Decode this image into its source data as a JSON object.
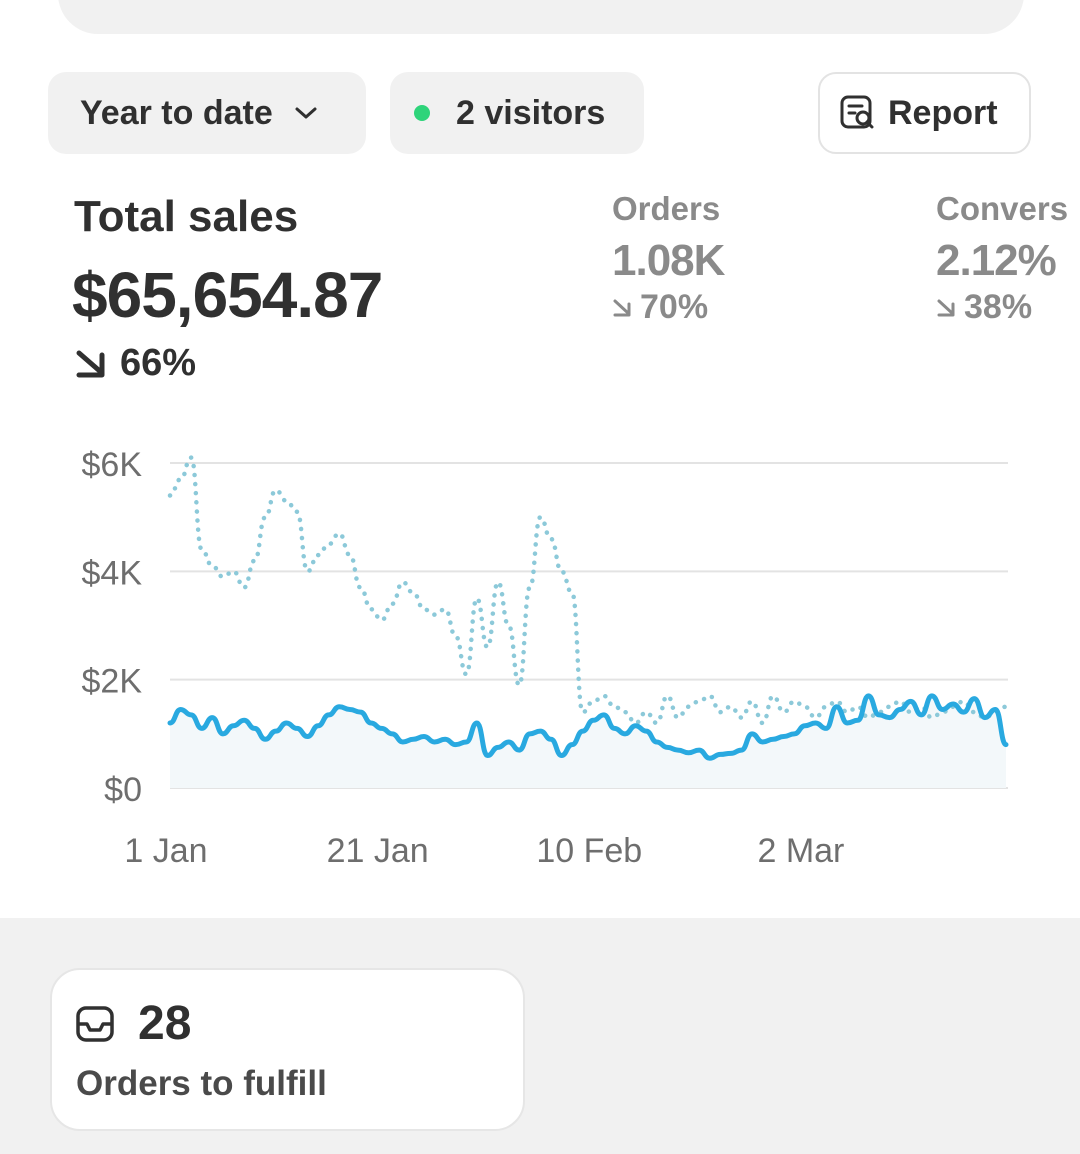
{
  "filters": {
    "date_range": "Year to date",
    "visitors": "2 visitors",
    "report_label": "Report"
  },
  "metrics": {
    "total_sales": {
      "title": "Total sales",
      "value": "$65,654.87",
      "change": "66%"
    },
    "orders": {
      "title": "Orders",
      "value": "1.08K",
      "change": "70%"
    },
    "conversion": {
      "title": "Convers",
      "value": "2.12%",
      "change": "38%"
    }
  },
  "colors": {
    "current_line": "#29a9e0",
    "previous_line": "#8cc9d9",
    "live_dot": "#2ed47a",
    "grid": "#e3e3e3",
    "axis_text": "#6e6e6e"
  },
  "fulfill": {
    "count": "28",
    "label": "Orders to fulfill"
  },
  "chart_data": {
    "type": "line",
    "x_tick_labels": [
      "1 Jan",
      "21 Jan",
      "10 Feb",
      "2 Mar"
    ],
    "y_tick_labels": [
      "$6K",
      "$4K",
      "$2K",
      "$0"
    ],
    "y_ticks": [
      6000,
      4000,
      2000,
      0
    ],
    "ylim": [
      0,
      6000
    ],
    "x_days": [
      1,
      80
    ],
    "grid": true,
    "series": [
      {
        "style": "solid",
        "color": "#29a9e0",
        "values": [
          1200,
          1450,
          1350,
          1100,
          1300,
          1000,
          1150,
          1250,
          1100,
          900,
          1050,
          1200,
          1100,
          950,
          1150,
          1350,
          1500,
          1450,
          1400,
          1200,
          1100,
          1000,
          850,
          900,
          950,
          850,
          900,
          800,
          850,
          1200,
          600,
          750,
          850,
          700,
          1000,
          1050,
          900,
          600,
          800,
          1050,
          1250,
          1350,
          1100,
          1000,
          1150,
          1050,
          850,
          750,
          700,
          650,
          700,
          550,
          620,
          640,
          700,
          1000,
          850,
          900,
          950,
          1000,
          1150,
          1200,
          1100,
          1500,
          1200,
          1250,
          1700,
          1350,
          1300,
          1450,
          1600,
          1350,
          1700,
          1450,
          1550,
          1400,
          1650,
          1300,
          1450,
          800
        ]
      },
      {
        "style": "dotted",
        "color": "#8cc9d9",
        "values": [
          5400,
          5700,
          6100,
          4400,
          4100,
          3900,
          4000,
          3700,
          4200,
          5000,
          5500,
          5300,
          5100,
          4000,
          4300,
          4500,
          4700,
          4300,
          3700,
          3300,
          3100,
          3400,
          3800,
          3600,
          3300,
          3200,
          3300,
          2800,
          2100,
          3500,
          2600,
          3800,
          3000,
          1900,
          3700,
          5000,
          4600,
          4000,
          3600,
          1400,
          1600,
          1700,
          1500,
          1400,
          1200,
          1400,
          1200,
          1700,
          1300,
          1500,
          1600,
          1700,
          1400,
          1500,
          1300,
          1600,
          1200,
          1700,
          1400,
          1600,
          1500,
          1300,
          1500,
          1600,
          1400,
          1500,
          1300,
          1400,
          1500,
          1600,
          1400,
          1500,
          1300,
          1400,
          1500,
          1600,
          1400,
          1300,
          1400,
          1500
        ]
      }
    ]
  }
}
